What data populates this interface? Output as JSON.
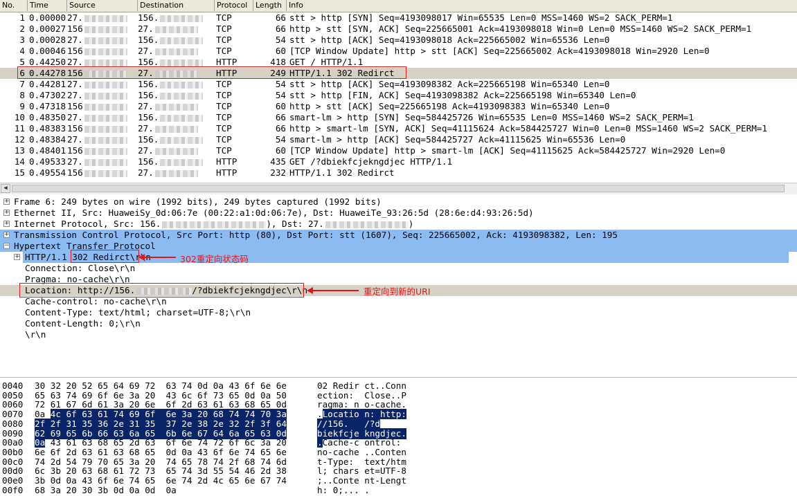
{
  "packet_list": {
    "columns": [
      "No.",
      "Time",
      "Source",
      "Destination",
      "Protocol",
      "Length",
      "Info"
    ],
    "rows": [
      {
        "no": "1",
        "time": "0.00000",
        "src": "27.",
        "dst": "156.",
        "proto": "TCP",
        "len": "66",
        "info": "stt > http [SYN] Seq=4193098017 Win=65535 Len=0 MSS=1460 WS=2 SACK_PERM=1"
      },
      {
        "no": "2",
        "time": "0.00027",
        "src": "156",
        "dst": "27.",
        "proto": "TCP",
        "len": "66",
        "info": "http > stt [SYN, ACK] Seq=225665001 Ack=4193098018 Win=0 Len=0 MSS=1460 WS=2 SACK_PERM=1"
      },
      {
        "no": "3",
        "time": "0.00028",
        "src": "27.",
        "dst": "156.",
        "proto": "TCP",
        "len": "54",
        "info": "stt > http [ACK] Seq=4193098018 Ack=225665002 Win=65536 Len=0"
      },
      {
        "no": "4",
        "time": "0.00046",
        "src": "156",
        "dst": "27.",
        "proto": "TCP",
        "len": "60",
        "info": "[TCP Window Update] http > stt [ACK] Seq=225665002 Ack=4193098018 Win=2920 Len=0"
      },
      {
        "no": "5",
        "time": "0.44250",
        "src": "27.",
        "dst": "156.",
        "proto": "HTTP",
        "len": "418",
        "info": "GET / HTTP/1.1"
      },
      {
        "no": "6",
        "time": "0.44278",
        "src": "156",
        "dst": "27.",
        "proto": "HTTP",
        "len": "249",
        "info": "HTTP/1.1 302 Redirct"
      },
      {
        "no": "7",
        "time": "0.44281",
        "src": "27.",
        "dst": "156.",
        "proto": "TCP",
        "len": "54",
        "info": "stt > http [ACK] Seq=4193098382 Ack=225665198 Win=65340 Len=0"
      },
      {
        "no": "8",
        "time": "0.47302",
        "src": "27.",
        "dst": "156.",
        "proto": "TCP",
        "len": "54",
        "info": "stt > http [FIN, ACK] Seq=4193098382 Ack=225665198 Win=65340 Len=0"
      },
      {
        "no": "9",
        "time": "0.47318",
        "src": "156",
        "dst": "27.",
        "proto": "TCP",
        "len": "60",
        "info": "http > stt [ACK] Seq=225665198 Ack=4193098383 Win=65340 Len=0"
      },
      {
        "no": "10",
        "time": "0.48350",
        "src": "27.",
        "dst": "156.",
        "proto": "TCP",
        "len": "66",
        "info": "smart-lm > http [SYN] Seq=584425726 Win=65535 Len=0 MSS=1460 WS=2 SACK_PERM=1"
      },
      {
        "no": "11",
        "time": "0.48383",
        "src": "156",
        "dst": "27.",
        "proto": "TCP",
        "len": "66",
        "info": "http > smart-lm [SYN, ACK] Seq=41115624 Ack=584425727 Win=0 Len=0 MSS=1460 WS=2 SACK_PERM=1"
      },
      {
        "no": "12",
        "time": "0.48384",
        "src": "27.",
        "dst": "156.",
        "proto": "TCP",
        "len": "54",
        "info": "smart-lm > http [ACK] Seq=584425727 Ack=41115625 Win=65536 Len=0"
      },
      {
        "no": "13",
        "time": "0.48401",
        "src": "156",
        "dst": "27.",
        "proto": "TCP",
        "len": "60",
        "info": "[TCP Window Update] http > smart-lm [ACK] Seq=41115625 Ack=584425727 Win=2920 Len=0"
      },
      {
        "no": "14",
        "time": "0.49533",
        "src": "27.",
        "dst": "156.",
        "proto": "HTTP",
        "len": "435",
        "info": "GET /?dbiekfcjekngdjec HTTP/1.1"
      },
      {
        "no": "15",
        "time": "0.49554",
        "src": "156",
        "dst": "27.",
        "proto": "HTTP",
        "len": "232",
        "info": "HTTP/1.1 302 Redirct"
      }
    ]
  },
  "details": {
    "frame": "Frame 6: 249 bytes on wire (1992 bits), 249 bytes captured (1992 bits)",
    "ethernet": "Ethernet II, Src: HuaweiSy_0d:06:7e (00:22:a1:0d:06:7e), Dst: HuaweiTe_93:26:5d (28:6e:d4:93:26:5d)",
    "ip_prefix": "Internet Protocol, Src: 156.",
    "ip_mid": "), Dst: 27.",
    "ip_suffix": ")",
    "tcp": "Transmission Control Protocol, Src Port: http (80), Dst Port: stt (1607), Seq: 225665002, Ack: 4193098382, Len: 195",
    "http": "Hypertext Transfer Protocol",
    "status_prefix": "HTTP/1.1",
    "status_code": "302 Redirct",
    "status_suffix": "\\r\\n",
    "connection": "Connection: Close\\r\\n",
    "pragma": "Pragma: no-cache\\r\\n",
    "location_prefix": "Location: http://156.",
    "location_suffix": "/?dbiekfcjekngdjec\\r\\n",
    "cache_control": "Cache-control: no-cache\\r\\n",
    "content_type": "Content-Type: text/html; charset=UTF-8;\\r\\n",
    "content_length": "Content-Length: 0;\\r\\n",
    "crlf": "\\r\\n"
  },
  "annotations": {
    "status_label": "302重定向状态码",
    "location_label": "重定向到新的URI"
  },
  "hex_dump": [
    {
      "off": "0040",
      "bytes": "30 32 20 52 65 64 69 72  63 74 0d 0a 43 6f 6e 6e",
      "ascii": "02 Redir ct..Conn"
    },
    {
      "off": "0050",
      "bytes": "65 63 74 69 6f 6e 3a 20  43 6c 6f 73 65 0d 0a 50",
      "ascii": "ection:  Close..P"
    },
    {
      "off": "0060",
      "bytes": "72 61 67 6d 61 3a 20 6e  6f 2d 63 61 63 68 65 0d",
      "ascii": "ragma: n o-cache."
    },
    {
      "off": "0070",
      "bytes": "0a 4c 6f 63 61 74 69 6f  6e 3a 20 68 74 74 70 3a",
      "ascii": ".Locatio n: http:"
    },
    {
      "off": "0080",
      "bytes": "2f 2f 31 35 36 2e 31 35  37 2e 38 2e 32 2f 3f 64",
      "ascii": "//156.   /?d"
    },
    {
      "off": "0090",
      "bytes": "62 69 65 6b 66 63 6a 65  6b 6e 67 64 6a 65 63 0d",
      "ascii": "biekfcje kngdjec."
    },
    {
      "off": "00a0",
      "bytes": "0a 43 61 63 68 65 2d 63  6f 6e 74 72 6f 6c 3a 20",
      "ascii": ".Cache-c ontrol: "
    },
    {
      "off": "00b0",
      "bytes": "6e 6f 2d 63 61 63 68 65  0d 0a 43 6f 6e 74 65 6e",
      "ascii": "no-cache ..Conten"
    },
    {
      "off": "00c0",
      "bytes": "74 2d 54 79 70 65 3a 20  74 65 78 74 2f 68 74 6d",
      "ascii": "t-Type:  text/htm"
    },
    {
      "off": "00d0",
      "bytes": "6c 3b 20 63 68 61 72 73  65 74 3d 55 54 46 2d 38",
      "ascii": "l; chars et=UTF-8"
    },
    {
      "off": "00e0",
      "bytes": "3b 0d 0a 43 6f 6e 74 65  6e 74 2d 4c 65 6e 67 74",
      "ascii": ";..Conte nt-Lengt"
    },
    {
      "off": "00f0",
      "bytes": "68 3a 20 30 3b 0d 0a 0d  0a",
      "ascii": "h: 0;... ."
    }
  ],
  "colors": {
    "selection": "#d7d0c4",
    "highlight_blue": "#8bbbf0",
    "hex_highlight": "#0a246a",
    "annotation_red": "#e0161b"
  }
}
